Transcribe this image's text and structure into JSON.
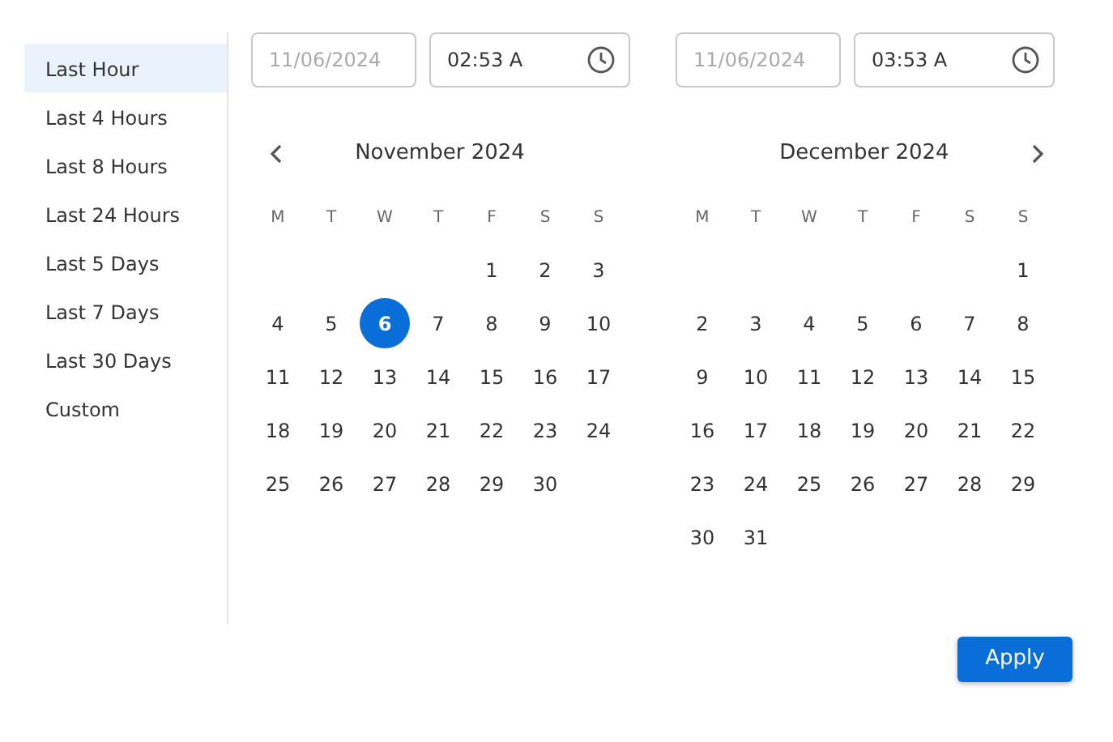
{
  "presets": [
    {
      "label": "Last Hour",
      "selected": true
    },
    {
      "label": "Last 4 Hours",
      "selected": false
    },
    {
      "label": "Last 8 Hours",
      "selected": false
    },
    {
      "label": "Last 24 Hours",
      "selected": false
    },
    {
      "label": "Last 5 Days",
      "selected": false
    },
    {
      "label": "Last 7 Days",
      "selected": false
    },
    {
      "label": "Last 30 Days",
      "selected": false
    },
    {
      "label": "Custom",
      "selected": false
    }
  ],
  "calendars": [
    {
      "kind": "start",
      "date_placeholder": "11/06/2024",
      "time": "02:53 A",
      "month": "November 2024",
      "weekdays": [
        "M",
        "T",
        "W",
        "T",
        "F",
        "S",
        "S"
      ],
      "weeks": [
        [
          {
            "kind": "blank"
          },
          {
            "kind": "blank"
          },
          {
            "kind": "blank"
          },
          {
            "kind": "blank"
          },
          {
            "kind": "day",
            "d": "1",
            "selected": false
          },
          {
            "kind": "day",
            "d": "2",
            "selected": false
          },
          {
            "kind": "day",
            "d": "3",
            "selected": false
          }
        ],
        [
          {
            "kind": "day",
            "d": "4",
            "selected": false
          },
          {
            "kind": "day",
            "d": "5",
            "selected": false
          },
          {
            "kind": "day",
            "d": "6",
            "selected": true
          },
          {
            "kind": "day",
            "d": "7",
            "selected": false
          },
          {
            "kind": "day",
            "d": "8",
            "selected": false
          },
          {
            "kind": "day",
            "d": "9",
            "selected": false
          },
          {
            "kind": "day",
            "d": "10",
            "selected": false
          }
        ],
        [
          {
            "kind": "day",
            "d": "11",
            "selected": false
          },
          {
            "kind": "day",
            "d": "12",
            "selected": false
          },
          {
            "kind": "day",
            "d": "13",
            "selected": false
          },
          {
            "kind": "day",
            "d": "14",
            "selected": false
          },
          {
            "kind": "day",
            "d": "15",
            "selected": false
          },
          {
            "kind": "day",
            "d": "16",
            "selected": false
          },
          {
            "kind": "day",
            "d": "17",
            "selected": false
          }
        ],
        [
          {
            "kind": "day",
            "d": "18",
            "selected": false
          },
          {
            "kind": "day",
            "d": "19",
            "selected": false
          },
          {
            "kind": "day",
            "d": "20",
            "selected": false
          },
          {
            "kind": "day",
            "d": "21",
            "selected": false
          },
          {
            "kind": "day",
            "d": "22",
            "selected": false
          },
          {
            "kind": "day",
            "d": "23",
            "selected": false
          },
          {
            "kind": "day",
            "d": "24",
            "selected": false
          }
        ],
        [
          {
            "kind": "day",
            "d": "25",
            "selected": false
          },
          {
            "kind": "day",
            "d": "26",
            "selected": false
          },
          {
            "kind": "day",
            "d": "27",
            "selected": false
          },
          {
            "kind": "day",
            "d": "28",
            "selected": false
          },
          {
            "kind": "day",
            "d": "29",
            "selected": false
          },
          {
            "kind": "day",
            "d": "30",
            "selected": false
          }
        ]
      ]
    },
    {
      "kind": "end",
      "date_placeholder": "11/06/2024",
      "time": "03:53 A",
      "month": "December 2024",
      "weekdays": [
        "M",
        "T",
        "W",
        "T",
        "F",
        "S",
        "S"
      ],
      "weeks": [
        [
          {
            "kind": "blank"
          },
          {
            "kind": "blank"
          },
          {
            "kind": "blank"
          },
          {
            "kind": "blank"
          },
          {
            "kind": "blank"
          },
          {
            "kind": "blank"
          },
          {
            "kind": "day",
            "d": "1",
            "selected": false
          }
        ],
        [
          {
            "kind": "day",
            "d": "2",
            "selected": false
          },
          {
            "kind": "day",
            "d": "3",
            "selected": false
          },
          {
            "kind": "day",
            "d": "4",
            "selected": false
          },
          {
            "kind": "day",
            "d": "5",
            "selected": false
          },
          {
            "kind": "day",
            "d": "6",
            "selected": false
          },
          {
            "kind": "day",
            "d": "7",
            "selected": false
          },
          {
            "kind": "day",
            "d": "8",
            "selected": false
          }
        ],
        [
          {
            "kind": "day",
            "d": "9",
            "selected": false
          },
          {
            "kind": "day",
            "d": "10",
            "selected": false
          },
          {
            "kind": "day",
            "d": "11",
            "selected": false
          },
          {
            "kind": "day",
            "d": "12",
            "selected": false
          },
          {
            "kind": "day",
            "d": "13",
            "selected": false
          },
          {
            "kind": "day",
            "d": "14",
            "selected": false
          },
          {
            "kind": "day",
            "d": "15",
            "selected": false
          }
        ],
        [
          {
            "kind": "day",
            "d": "16",
            "selected": false
          },
          {
            "kind": "day",
            "d": "17",
            "selected": false
          },
          {
            "kind": "day",
            "d": "18",
            "selected": false
          },
          {
            "kind": "day",
            "d": "19",
            "selected": false
          },
          {
            "kind": "day",
            "d": "20",
            "selected": false
          },
          {
            "kind": "day",
            "d": "21",
            "selected": false
          },
          {
            "kind": "day",
            "d": "22",
            "selected": false
          }
        ],
        [
          {
            "kind": "day",
            "d": "23",
            "selected": false
          },
          {
            "kind": "day",
            "d": "24",
            "selected": false
          },
          {
            "kind": "day",
            "d": "25",
            "selected": false
          },
          {
            "kind": "day",
            "d": "26",
            "selected": false
          },
          {
            "kind": "day",
            "d": "27",
            "selected": false
          },
          {
            "kind": "day",
            "d": "28",
            "selected": false
          },
          {
            "kind": "day",
            "d": "29",
            "selected": false
          }
        ],
        [
          {
            "kind": "day",
            "d": "30",
            "selected": false
          },
          {
            "kind": "day",
            "d": "31",
            "selected": false
          }
        ]
      ]
    }
  ],
  "apply_button": "Apply"
}
